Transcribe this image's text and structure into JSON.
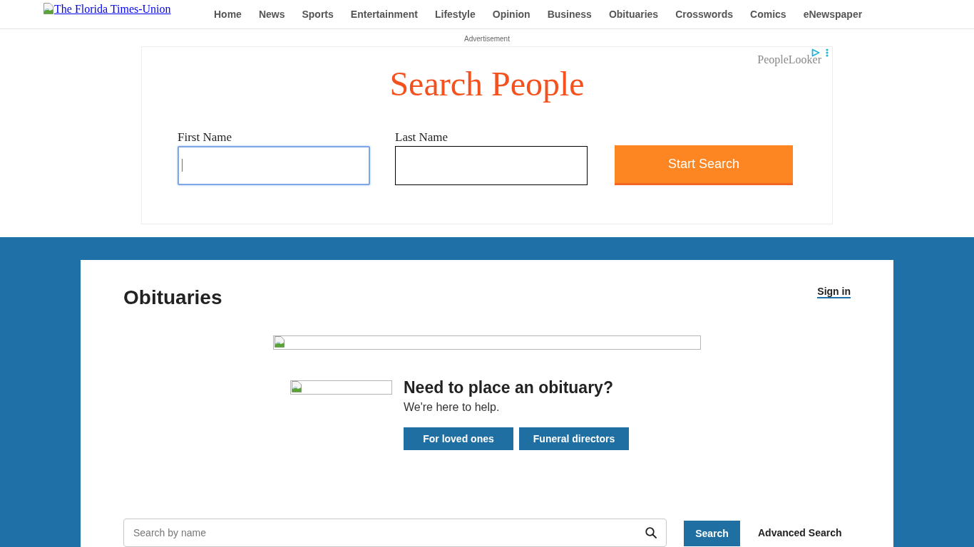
{
  "header": {
    "logo_alt_text": "The Florida Times-Union",
    "nav": [
      "Home",
      "News",
      "Sports",
      "Entertainment",
      "Lifestyle",
      "Opinion",
      "Business",
      "Obituaries",
      "Crosswords",
      "Comics",
      "eNewspaper"
    ]
  },
  "advertisement": {
    "label": "Advertisement",
    "headline": "Search People",
    "advertiser": "PeopleLooker",
    "fields": [
      {
        "label": "First Name",
        "focused": true
      },
      {
        "label": "Last Name",
        "focused": false
      }
    ],
    "button": "Start Search"
  },
  "obituaries": {
    "title": "Obituaries",
    "sign_in": "Sign in",
    "promo": {
      "title": "Need to place an obituary?",
      "subtitle": "We're here to help.",
      "buttons": [
        "For loved ones",
        "Funeral directors"
      ]
    },
    "search": {
      "placeholder": "Search by name",
      "button": "Search",
      "advanced_link": "Advanced Search"
    }
  }
}
